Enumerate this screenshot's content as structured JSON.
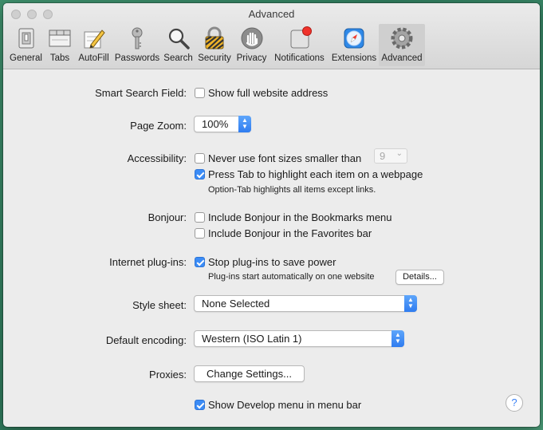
{
  "window": {
    "title": "Advanced"
  },
  "toolbar": {
    "tabs": [
      {
        "label": "General"
      },
      {
        "label": "Tabs"
      },
      {
        "label": "AutoFill"
      },
      {
        "label": "Passwords"
      },
      {
        "label": "Search"
      },
      {
        "label": "Security"
      },
      {
        "label": "Privacy"
      },
      {
        "label": "Notifications"
      },
      {
        "label": "Extensions"
      },
      {
        "label": "Advanced"
      }
    ],
    "selected": "Advanced"
  },
  "settings": {
    "smart_search": {
      "label": "Smart Search Field:",
      "option": "Show full website address",
      "checked": false
    },
    "page_zoom": {
      "label": "Page Zoom:",
      "value": "100%"
    },
    "accessibility": {
      "label": "Accessibility:",
      "min_font": {
        "option": "Never use font sizes smaller than",
        "checked": false,
        "size": "9"
      },
      "press_tab": {
        "option": "Press Tab to highlight each item on a webpage",
        "checked": true
      },
      "note": "Option-Tab highlights all items except links."
    },
    "bonjour": {
      "label": "Bonjour:",
      "bookmarks": {
        "option": "Include Bonjour in the Bookmarks menu",
        "checked": false
      },
      "favorites": {
        "option": "Include Bonjour in the Favorites bar",
        "checked": false
      }
    },
    "plugins": {
      "label": "Internet plug-ins:",
      "stop": {
        "option": "Stop plug-ins to save power",
        "checked": true
      },
      "note": "Plug-ins start automatically on one website",
      "details_button": "Details..."
    },
    "style_sheet": {
      "label": "Style sheet:",
      "value": "None Selected"
    },
    "encoding": {
      "label": "Default encoding:",
      "value": "Western (ISO Latin 1)"
    },
    "proxies": {
      "label": "Proxies:",
      "button": "Change Settings..."
    },
    "develop": {
      "option": "Show Develop menu in menu bar",
      "checked": true
    },
    "help": "?"
  },
  "colors": {
    "accent": "#3b8cf6",
    "window_bg": "#ececec"
  }
}
